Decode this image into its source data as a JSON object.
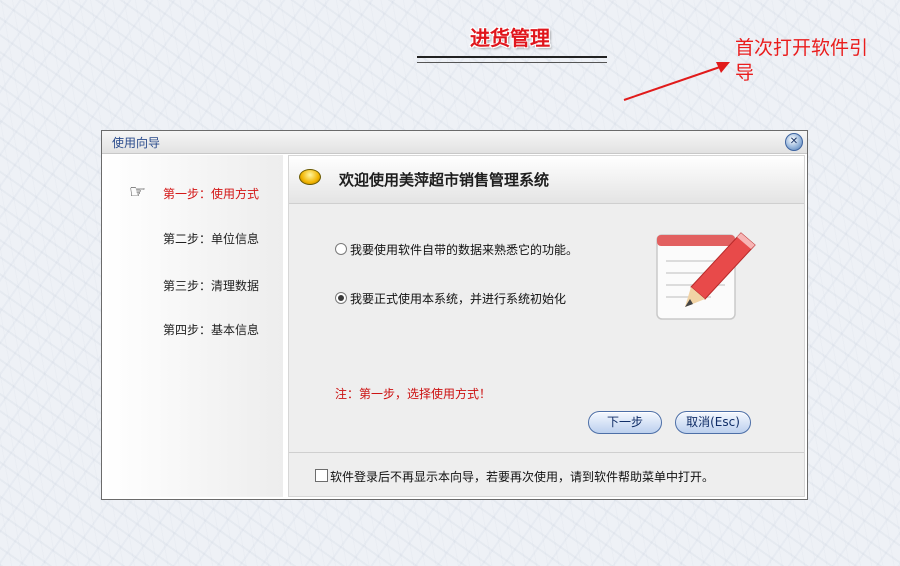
{
  "slide": {
    "title": "进货管理",
    "annotation": "首次打开软件引导"
  },
  "dialog": {
    "title": "使用向导",
    "close_icon": "close-icon",
    "steps": [
      {
        "label": "第一步：使用方式",
        "active": true
      },
      {
        "label": "第二步：单位信息",
        "active": false
      },
      {
        "label": "第三步：清理数据",
        "active": false
      },
      {
        "label": "第四步：基本信息",
        "active": false
      }
    ],
    "header_title": "欢迎使用美萍超市销售管理系统",
    "options": [
      {
        "label": "我要使用软件自带的数据来熟悉它的功能。",
        "selected": false
      },
      {
        "label": "我要正式使用本系统，并进行系统初始化",
        "selected": true
      }
    ],
    "note": "注：第一步，选择使用方式！",
    "next_label": "下一步",
    "cancel_label": "取消(Esc)",
    "dont_show_label": "软件登录后不再显示本向导，若要再次使用，请到软件帮助菜单中打开。",
    "dont_show_checked": false
  },
  "colors": {
    "accent_red": "#e0161c",
    "button_blue": "#4d6fa7"
  }
}
